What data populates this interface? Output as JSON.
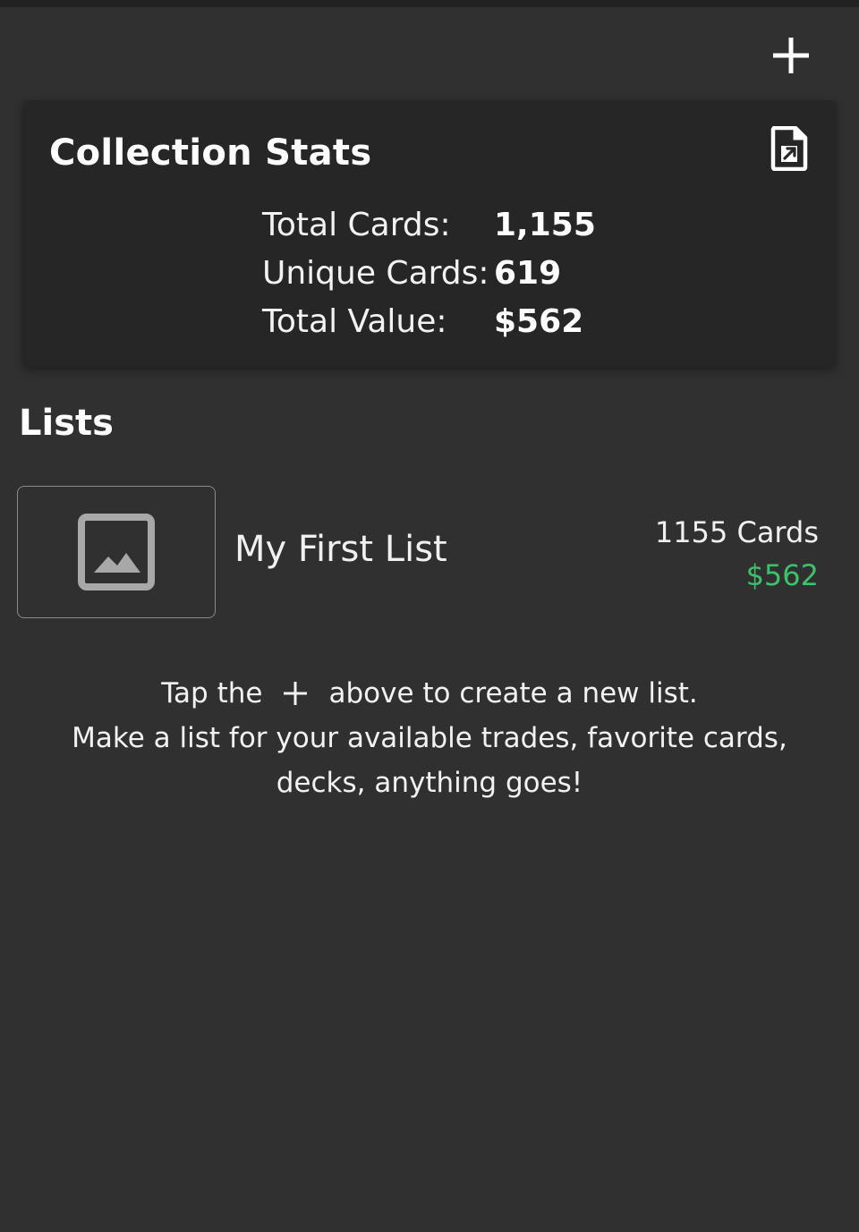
{
  "header": {
    "add_icon": "plus-icon"
  },
  "stats": {
    "title": "Collection Stats",
    "export_icon": "file-export-icon",
    "rows": [
      {
        "label": "Total Cards:",
        "value": "1,155"
      },
      {
        "label": "Unique Cards:",
        "value": "619"
      },
      {
        "label": "Total Value:",
        "value": "$562"
      }
    ]
  },
  "lists": {
    "heading": "Lists",
    "items": [
      {
        "name": "My First List",
        "count": "1155 Cards",
        "value": "$562",
        "thumbnail_icon": "image-placeholder-icon"
      }
    ]
  },
  "help": {
    "line1_before": "Tap the",
    "line1_after": "above to create a new list.",
    "line2": "Make a list for your available trades, favorite cards, decks, anything goes!"
  },
  "colors": {
    "background": "#303030",
    "card": "#262626",
    "accent_green": "#3fc06a"
  }
}
